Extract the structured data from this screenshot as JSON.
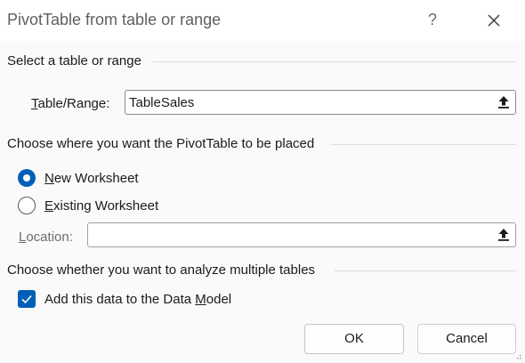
{
  "dialog": {
    "title": "PivotTable from table or range",
    "help_glyph": "?",
    "close_icon": "close-icon"
  },
  "select_section": {
    "heading": "Select a table or range",
    "table_range_label_underlined": "T",
    "table_range_label_rest": "able/Range:",
    "table_range_value": "TableSales"
  },
  "placement_section": {
    "heading": "Choose where you want the PivotTable to be placed",
    "new_worksheet_underlined": "N",
    "new_worksheet_rest": "ew Worksheet",
    "new_worksheet_checked": true,
    "existing_worksheet_underlined": "E",
    "existing_worksheet_rest": "xisting Worksheet",
    "existing_worksheet_checked": false,
    "location_label_underlined": "L",
    "location_label_rest": "ocation:",
    "location_value": ""
  },
  "multiple_tables_section": {
    "heading": "Choose whether you want to analyze multiple tables",
    "data_model_label_before": "Add this data to the Data ",
    "data_model_label_underlined": "M",
    "data_model_label_after": "odel",
    "data_model_checked": true
  },
  "buttons": {
    "ok_label": "OK",
    "cancel_label": "Cancel"
  },
  "colors": {
    "accent": "#005fb8"
  }
}
